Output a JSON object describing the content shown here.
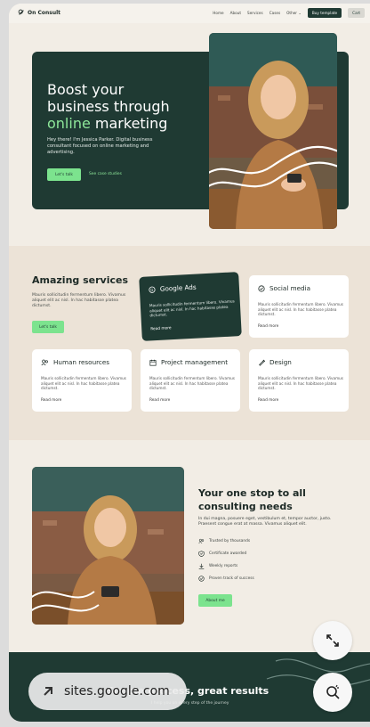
{
  "nav": {
    "brand": "On Consult",
    "links": [
      "Home",
      "About",
      "Services",
      "Cases",
      "Other"
    ],
    "buy_template": "Buy template",
    "cart": "Cart"
  },
  "hero": {
    "title_line1": "Boost your",
    "title_line2": "business through",
    "title_accent": "online",
    "title_rest": " marketing",
    "description": "Hey there! I'm Jessica Parker. Digital business consultant focused on online marketing and advertising.",
    "cta_primary": "Let's talk",
    "cta_secondary": "See case studies"
  },
  "services": {
    "title": "Amazing services",
    "description": "Mauris sollicitudin fermentum libero. Vivamus aliquet elit ac nisl. In hac habitasse platea dictumst.",
    "cta": "Let's talk",
    "cards": [
      {
        "title": "Google Ads",
        "icon": "google-ads-icon",
        "text": "Mauris sollicitudin fermentum libero. Vivamus aliquet elit ac nisl. In hac habitasse platea dictumst.",
        "more": "Read more"
      },
      {
        "title": "Social media",
        "icon": "social-media-icon",
        "text": "Mauris sollicitudin fermentum libero. Vivamus aliquet elit ac nisl. In hac habitasse platea dictumst.",
        "more": "Read more"
      },
      {
        "title": "Human resources",
        "icon": "people-icon",
        "text": "Mauris sollicitudin fermentum libero. Vivamus aliquet elit ac nisl. In hac habitasse platea dictumst.",
        "more": "Read more"
      },
      {
        "title": "Project management",
        "icon": "calendar-icon",
        "text": "Mauris sollicitudin fermentum libero. Vivamus aliquet elit ac nisl. In hac habitasse platea dictumst.",
        "more": "Read more"
      },
      {
        "title": "Design",
        "icon": "pen-icon",
        "text": "Mauris sollicitudin fermentum libero. Vivamus aliquet elit ac nisl. In hac habitasse platea dictumst.",
        "more": "Read more"
      }
    ]
  },
  "one_stop": {
    "title": "Your one stop to all consulting needs",
    "description": "In dui magna, posuere eget, vestibulum et, tempor auctor, justo. Praesent congue erat at massa. Vivamus aliquet elit.",
    "features": [
      "Trusted by thousands",
      "Certificate awarded",
      "Weekly reports",
      "Proven track of success"
    ],
    "cta": "About me"
  },
  "footer": {
    "title": "Simple process, great results",
    "subtitle": "I help you on every step of the journey"
  },
  "browser": {
    "url": "sites.google.com"
  },
  "colors": {
    "dark_green": "#1f3a33",
    "accent_green": "#7ce38e",
    "cream": "#f2ede5",
    "beige": "#ece3d7"
  }
}
